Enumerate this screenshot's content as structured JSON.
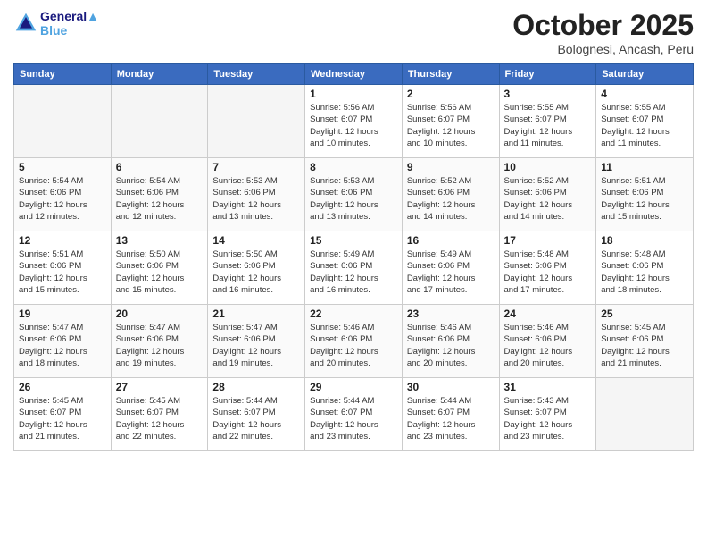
{
  "logo": {
    "line1": "General",
    "line2": "Blue"
  },
  "title": "October 2025",
  "location": "Bolognesi, Ancash, Peru",
  "days_header": [
    "Sunday",
    "Monday",
    "Tuesday",
    "Wednesday",
    "Thursday",
    "Friday",
    "Saturday"
  ],
  "weeks": [
    [
      {
        "day": "",
        "info": ""
      },
      {
        "day": "",
        "info": ""
      },
      {
        "day": "",
        "info": ""
      },
      {
        "day": "1",
        "info": "Sunrise: 5:56 AM\nSunset: 6:07 PM\nDaylight: 12 hours\nand 10 minutes."
      },
      {
        "day": "2",
        "info": "Sunrise: 5:56 AM\nSunset: 6:07 PM\nDaylight: 12 hours\nand 10 minutes."
      },
      {
        "day": "3",
        "info": "Sunrise: 5:55 AM\nSunset: 6:07 PM\nDaylight: 12 hours\nand 11 minutes."
      },
      {
        "day": "4",
        "info": "Sunrise: 5:55 AM\nSunset: 6:07 PM\nDaylight: 12 hours\nand 11 minutes."
      }
    ],
    [
      {
        "day": "5",
        "info": "Sunrise: 5:54 AM\nSunset: 6:06 PM\nDaylight: 12 hours\nand 12 minutes."
      },
      {
        "day": "6",
        "info": "Sunrise: 5:54 AM\nSunset: 6:06 PM\nDaylight: 12 hours\nand 12 minutes."
      },
      {
        "day": "7",
        "info": "Sunrise: 5:53 AM\nSunset: 6:06 PM\nDaylight: 12 hours\nand 13 minutes."
      },
      {
        "day": "8",
        "info": "Sunrise: 5:53 AM\nSunset: 6:06 PM\nDaylight: 12 hours\nand 13 minutes."
      },
      {
        "day": "9",
        "info": "Sunrise: 5:52 AM\nSunset: 6:06 PM\nDaylight: 12 hours\nand 14 minutes."
      },
      {
        "day": "10",
        "info": "Sunrise: 5:52 AM\nSunset: 6:06 PM\nDaylight: 12 hours\nand 14 minutes."
      },
      {
        "day": "11",
        "info": "Sunrise: 5:51 AM\nSunset: 6:06 PM\nDaylight: 12 hours\nand 15 minutes."
      }
    ],
    [
      {
        "day": "12",
        "info": "Sunrise: 5:51 AM\nSunset: 6:06 PM\nDaylight: 12 hours\nand 15 minutes."
      },
      {
        "day": "13",
        "info": "Sunrise: 5:50 AM\nSunset: 6:06 PM\nDaylight: 12 hours\nand 15 minutes."
      },
      {
        "day": "14",
        "info": "Sunrise: 5:50 AM\nSunset: 6:06 PM\nDaylight: 12 hours\nand 16 minutes."
      },
      {
        "day": "15",
        "info": "Sunrise: 5:49 AM\nSunset: 6:06 PM\nDaylight: 12 hours\nand 16 minutes."
      },
      {
        "day": "16",
        "info": "Sunrise: 5:49 AM\nSunset: 6:06 PM\nDaylight: 12 hours\nand 17 minutes."
      },
      {
        "day": "17",
        "info": "Sunrise: 5:48 AM\nSunset: 6:06 PM\nDaylight: 12 hours\nand 17 minutes."
      },
      {
        "day": "18",
        "info": "Sunrise: 5:48 AM\nSunset: 6:06 PM\nDaylight: 12 hours\nand 18 minutes."
      }
    ],
    [
      {
        "day": "19",
        "info": "Sunrise: 5:47 AM\nSunset: 6:06 PM\nDaylight: 12 hours\nand 18 minutes."
      },
      {
        "day": "20",
        "info": "Sunrise: 5:47 AM\nSunset: 6:06 PM\nDaylight: 12 hours\nand 19 minutes."
      },
      {
        "day": "21",
        "info": "Sunrise: 5:47 AM\nSunset: 6:06 PM\nDaylight: 12 hours\nand 19 minutes."
      },
      {
        "day": "22",
        "info": "Sunrise: 5:46 AM\nSunset: 6:06 PM\nDaylight: 12 hours\nand 20 minutes."
      },
      {
        "day": "23",
        "info": "Sunrise: 5:46 AM\nSunset: 6:06 PM\nDaylight: 12 hours\nand 20 minutes."
      },
      {
        "day": "24",
        "info": "Sunrise: 5:46 AM\nSunset: 6:06 PM\nDaylight: 12 hours\nand 20 minutes."
      },
      {
        "day": "25",
        "info": "Sunrise: 5:45 AM\nSunset: 6:06 PM\nDaylight: 12 hours\nand 21 minutes."
      }
    ],
    [
      {
        "day": "26",
        "info": "Sunrise: 5:45 AM\nSunset: 6:07 PM\nDaylight: 12 hours\nand 21 minutes."
      },
      {
        "day": "27",
        "info": "Sunrise: 5:45 AM\nSunset: 6:07 PM\nDaylight: 12 hours\nand 22 minutes."
      },
      {
        "day": "28",
        "info": "Sunrise: 5:44 AM\nSunset: 6:07 PM\nDaylight: 12 hours\nand 22 minutes."
      },
      {
        "day": "29",
        "info": "Sunrise: 5:44 AM\nSunset: 6:07 PM\nDaylight: 12 hours\nand 23 minutes."
      },
      {
        "day": "30",
        "info": "Sunrise: 5:44 AM\nSunset: 6:07 PM\nDaylight: 12 hours\nand 23 minutes."
      },
      {
        "day": "31",
        "info": "Sunrise: 5:43 AM\nSunset: 6:07 PM\nDaylight: 12 hours\nand 23 minutes."
      },
      {
        "day": "",
        "info": ""
      }
    ]
  ]
}
